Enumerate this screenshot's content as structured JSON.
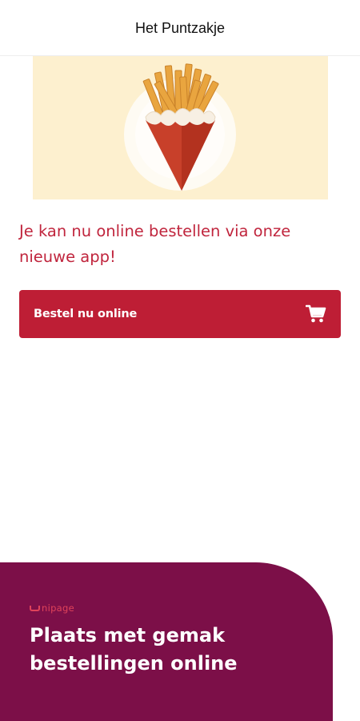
{
  "header": {
    "title": "Het Puntzakje"
  },
  "hero": {
    "image": "fries-cone-illustration"
  },
  "main": {
    "intro_text": "Je kan nu online bestellen via onze nieuwe app!",
    "order_button": {
      "label": "Bestel nu online",
      "icon": "shopping-cart-icon"
    }
  },
  "promo": {
    "brand": "nipage",
    "title": "Plaats met gemak bestellingen online"
  },
  "colors": {
    "accent": "#be1e35",
    "intro_text": "#c0253d",
    "promo_background": "#7c0f48",
    "brand": "#e0435a",
    "hero_background": "#fdf0cf"
  }
}
